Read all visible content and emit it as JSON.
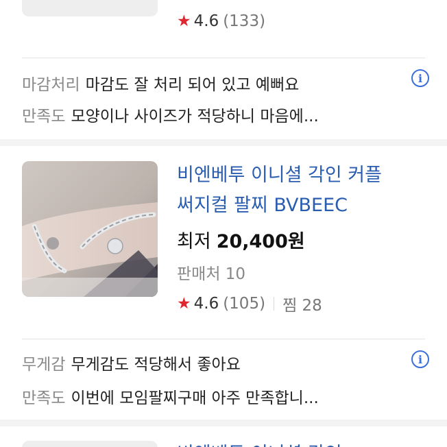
{
  "top_item": {
    "rating": "4.6",
    "review_count": "(133)"
  },
  "review_1": {
    "line1_tag": "마감처리",
    "line1_text": "마감도 잘 처리 되어 있고 예뻐요",
    "line2_tag": "만족도",
    "line2_text": "모양이나 사이즈가 적당하니 마음에..."
  },
  "product": {
    "title_line1": "비엔베투 이니셜 각인 커플",
    "title_line2": "써지컬 팔찌 BVBEEC",
    "price_label": "최저",
    "price_amount": "20,400원",
    "sellers": "판매처 10",
    "rating": "4.6",
    "review_count": "(105)",
    "zzim": "찜 28"
  },
  "review_2": {
    "line1_tag": "무게감",
    "line1_text": "무게감도 적당해서 좋아요",
    "line2_tag": "만족도",
    "line2_text": "이번에 모임팔찌구매 아주 만족합니..."
  },
  "next_item": {
    "title_partial": "비엔베투 이니셜 각인"
  },
  "colors": {
    "link_blue": "#2a5db0",
    "star_red": "#e0262e",
    "info_blue": "#3a6fd8"
  },
  "icons": {
    "star": "star-icon",
    "info": "info-icon"
  }
}
